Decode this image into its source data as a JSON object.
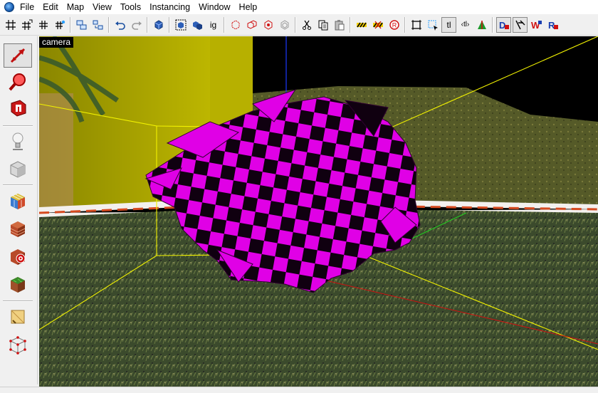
{
  "menu": {
    "items": [
      "File",
      "Edit",
      "Map",
      "View",
      "Tools",
      "Instancing",
      "Window",
      "Help"
    ]
  },
  "toolbar": {
    "buttons": [
      "grid-icon",
      "grid-snap-icon",
      "grid-small-icon",
      "grid-point-icon",
      "group-icon",
      "ungroup-icon",
      "undo-icon",
      "redo-icon",
      "box-select-icon",
      "select-all-icon",
      "select-invert-icon",
      "select-group-icon",
      "copy-to-icon",
      "duplicate-icon",
      "clone-icon",
      "instance-icon",
      "cut-icon",
      "copy-icon",
      "paste-icon",
      "hazard-stripe-icon",
      "hazard-stripe-x-icon",
      "record-icon",
      "frame-icon",
      "frame-select-icon",
      "text-toggle-icon",
      "move-axis-icon",
      "bake-icon",
      "draw-mode-icon",
      "wireframe-icon",
      "render-mode-icon",
      "reflect-icon"
    ],
    "text_button": "tl",
    "text_button2": "‹tl›"
  },
  "sidebar": {
    "tools": [
      "select-arrow-tool-icon",
      "zoom-tool-icon",
      "magnet-tool-icon",
      "light-tool-icon",
      "cube-tool-icon",
      "texture-cube-icon",
      "brick-cube-icon",
      "target-cube-icon",
      "grass-cube-icon",
      "paint-tool-icon",
      "wire-cube-icon"
    ]
  },
  "viewport": {
    "label": "camera"
  },
  "colors": {
    "wall": "#b7b000",
    "blob": "#e000e6",
    "ground": "#3b4a2c",
    "hill": "#5b5e2a",
    "selection_box": "#f2f200"
  }
}
